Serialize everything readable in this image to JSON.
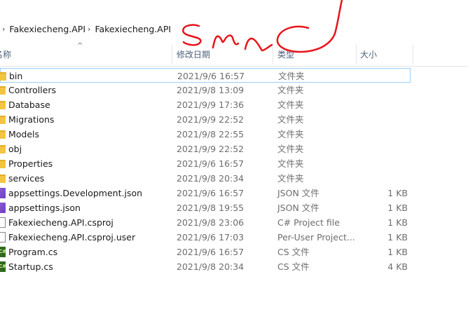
{
  "breadcrumb": {
    "items": [
      "Fakexiecheng.API",
      "Fakexiecheng.API"
    ],
    "sep": "›"
  },
  "columns": {
    "name": "名称",
    "date": "修改日期",
    "type": "类型",
    "size": "大小"
  },
  "files": [
    {
      "name": "bin",
      "date": "2021/9/6 16:57",
      "type": "文件夹",
      "size": "",
      "icon": "folder-icon"
    },
    {
      "name": "Controllers",
      "date": "2021/9/8 13:09",
      "type": "文件夹",
      "size": "",
      "icon": "folder-icon"
    },
    {
      "name": "Database",
      "date": "2021/9/9 17:36",
      "type": "文件夹",
      "size": "",
      "icon": "folder-icon"
    },
    {
      "name": "Migrations",
      "date": "2021/9/9 22:52",
      "type": "文件夹",
      "size": "",
      "icon": "folder-icon"
    },
    {
      "name": "Models",
      "date": "2021/9/8 22:55",
      "type": "文件夹",
      "size": "",
      "icon": "folder-icon"
    },
    {
      "name": "obj",
      "date": "2021/9/9 22:52",
      "type": "文件夹",
      "size": "",
      "icon": "folder-icon"
    },
    {
      "name": "Properties",
      "date": "2021/9/6 16:57",
      "type": "文件夹",
      "size": "",
      "icon": "folder-icon"
    },
    {
      "name": "services",
      "date": "2021/9/8 20:34",
      "type": "文件夹",
      "size": "",
      "icon": "folder-icon"
    },
    {
      "name": "appsettings.Development.json",
      "date": "2021/9/6 16:57",
      "type": "JSON 文件",
      "size": "1 KB",
      "icon": "vs-icon"
    },
    {
      "name": "appsettings.json",
      "date": "2021/9/8 19:55",
      "type": "JSON 文件",
      "size": "1 KB",
      "icon": "vs-icon"
    },
    {
      "name": "Fakexiecheng.API.csproj",
      "date": "2021/9/8 23:06",
      "type": "C# Project file",
      "size": "1 KB",
      "icon": "doc-icon"
    },
    {
      "name": "Fakexiecheng.API.csproj.user",
      "date": "2021/9/6 17:03",
      "type": "Per-User Project...",
      "size": "1 KB",
      "icon": "doc-icon"
    },
    {
      "name": "Program.cs",
      "date": "2021/9/6 16:57",
      "type": "CS 文件",
      "size": "1 KB",
      "icon": "cs-icon"
    },
    {
      "name": "Startup.cs",
      "date": "2021/9/8 20:34",
      "type": "CS 文件",
      "size": "4 KB",
      "icon": "cs-icon"
    }
  ],
  "cs_icon_label": "C#",
  "colors": {
    "annotation": "#e8141b",
    "folder": "#f4c542",
    "selection_border": "#99d1ff",
    "header_text": "#4c607a"
  }
}
